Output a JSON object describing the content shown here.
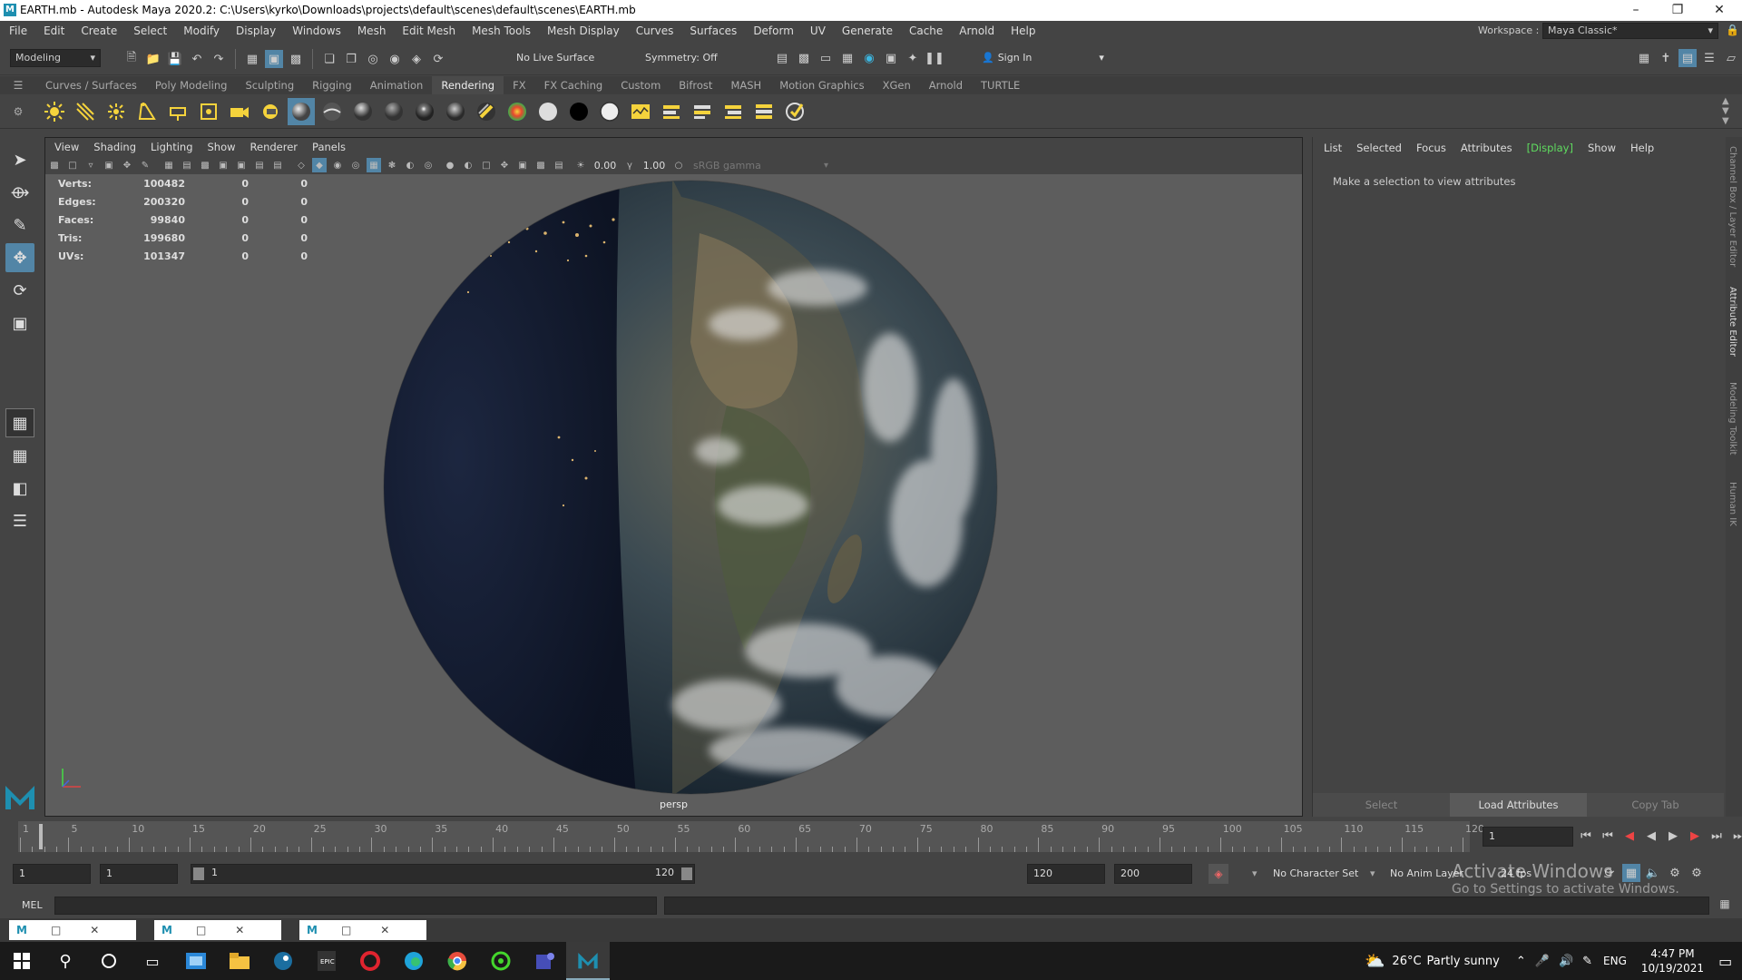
{
  "window": {
    "title": "EARTH.mb - Autodesk Maya 2020.2: C:\\Users\\kyrko\\Downloads\\projects\\default\\scenes\\default\\scenes\\EARTH.mb"
  },
  "menubar": [
    "File",
    "Edit",
    "Create",
    "Select",
    "Modify",
    "Display",
    "Windows",
    "Mesh",
    "Edit Mesh",
    "Mesh Tools",
    "Mesh Display",
    "Curves",
    "Surfaces",
    "Deform",
    "UV",
    "Generate",
    "Cache",
    "Arnold",
    "Help"
  ],
  "workspace": {
    "label": "Workspace :",
    "value": "Maya Classic*"
  },
  "statusline": {
    "menuset": "Modeling",
    "live_surface": "No Live Surface",
    "symmetry": "Symmetry: Off",
    "sign_in": "Sign In"
  },
  "shelf_tabs": [
    "Curves / Surfaces",
    "Poly Modeling",
    "Sculpting",
    "Rigging",
    "Animation",
    "Rendering",
    "FX",
    "FX Caching",
    "Custom",
    "Bifrost",
    "MASH",
    "Motion Graphics",
    "XGen",
    "Arnold",
    "TURTLE"
  ],
  "active_shelf": "Rendering",
  "shelf_icons": [
    "ambient-light",
    "directional-light",
    "point-light",
    "spot-light",
    "area-light",
    "volume-light",
    "camera",
    "render-settings",
    "sphere-shader-1",
    "sphere-shader-2",
    "sphere-shader-3",
    "sphere-shader-4",
    "sphere-shader-5",
    "sphere-shader-6",
    "sphere-shader-7",
    "color-sphere",
    "white-sphere",
    "black-sphere",
    "white-sphere-2",
    "hypershade",
    "render-view",
    "ipr-render",
    "render-frame",
    "batch-render",
    "render-sequence"
  ],
  "viewport": {
    "menu": [
      "View",
      "Shading",
      "Lighting",
      "Show",
      "Renderer",
      "Panels"
    ],
    "exposure": "0.00",
    "gamma": "1.00",
    "colorspace": "sRGB gamma",
    "camera": "persp",
    "hud": [
      {
        "label": "Verts:",
        "value": "100482",
        "a": "0",
        "b": "0"
      },
      {
        "label": "Edges:",
        "value": "200320",
        "a": "0",
        "b": "0"
      },
      {
        "label": "Faces:",
        "value": "99840",
        "a": "0",
        "b": "0"
      },
      {
        "label": "Tris:",
        "value": "199680",
        "a": "0",
        "b": "0"
      },
      {
        "label": "UVs:",
        "value": "101347",
        "a": "0",
        "b": "0"
      }
    ]
  },
  "attribute_editor": {
    "menu": [
      "List",
      "Selected",
      "Focus",
      "Attributes",
      "[Display]",
      "Show",
      "Help"
    ],
    "active_menu": "[Display]",
    "message": "Make a selection to view attributes",
    "buttons": [
      "Select",
      "Load Attributes",
      "Copy Tab"
    ]
  },
  "side_tabs": [
    "Channel Box / Layer Editor",
    "Attribute Editor",
    "Modeling Toolkit",
    "Human IK"
  ],
  "timeline": {
    "ticks": [
      "1",
      "5",
      "10",
      "15",
      "20",
      "25",
      "30",
      "35",
      "40",
      "45",
      "50",
      "55",
      "60",
      "65",
      "70",
      "75",
      "80",
      "85",
      "90",
      "95",
      "100",
      "105",
      "110",
      "115",
      "120"
    ],
    "current_frame": "1"
  },
  "range": {
    "start": "1",
    "inner_start": "1",
    "slider_start": "1",
    "slider_end": "120",
    "end": "120",
    "outer_end": "200",
    "character_set": "No Character Set",
    "anim_layer": "No Anim Layer",
    "fps": "24 fps"
  },
  "mel": {
    "label": "MEL"
  },
  "activate": {
    "line1": "Activate Windows",
    "line2": "Go to Settings to activate Windows."
  },
  "taskbar": {
    "weather_temp": "26°C",
    "weather_text": "Partly sunny",
    "lang": "ENG",
    "time": "4:47 PM",
    "date": "10/19/2021"
  },
  "colors": {
    "accent": "#5285a6",
    "highlight_green": "#5fdc5f",
    "maya_teal": "#1e8fb0"
  }
}
